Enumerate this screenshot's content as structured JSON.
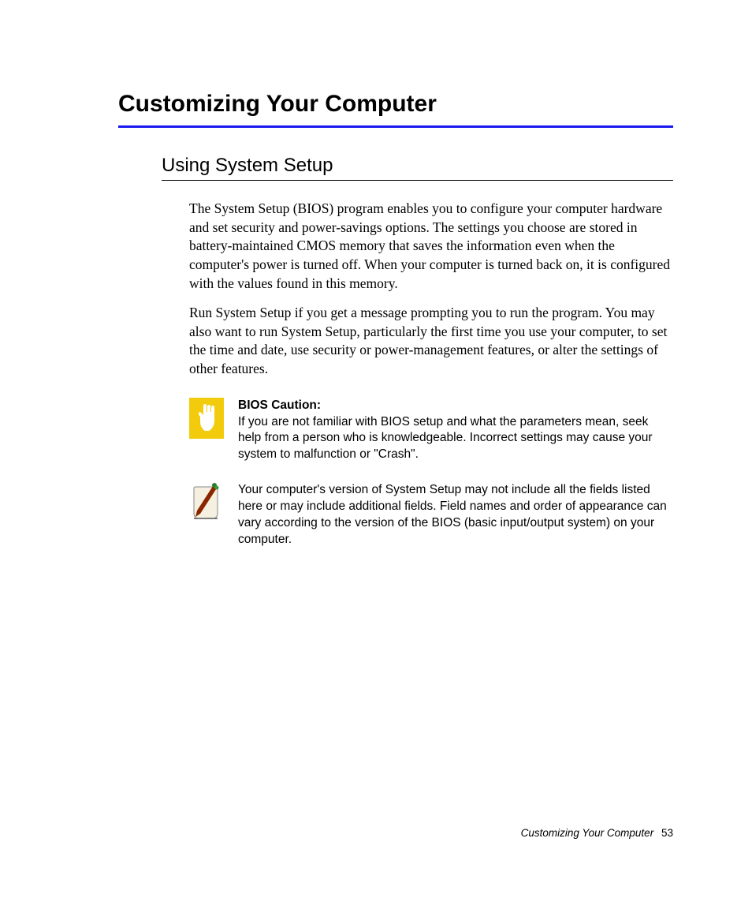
{
  "chapter_title": "Customizing Your Computer",
  "section_title": "Using System Setup",
  "paragraphs": {
    "p1": "The System Setup (BIOS) program enables you to configure your computer hardware and set security and power-savings options. The settings you choose are stored in battery-maintained CMOS memory that saves the information even when the computer's power is turned off. When your computer is turned back on, it is configured with the values found in this memory.",
    "p2": "Run System Setup if you get a message prompting you to run the program. You may also want to run System Setup, particularly the first time you use your computer, to set the time and date, use security or power-management features, or alter the settings of other features."
  },
  "callouts": {
    "caution": {
      "title": "BIOS Caution:",
      "body": "If you are not familiar with BIOS setup and what the parameters mean, seek help from a person who is knowledgeable. Incorrect settings may cause your system to malfunction or \"Crash\"."
    },
    "note": {
      "body": "Your computer's version of System Setup may not include all the fields listed here or may include additional fields. Field names and order of appearance can vary according to the version of the BIOS (basic input/output system) on your computer."
    }
  },
  "footer": {
    "title": "Customizing Your Computer",
    "page_number": "53"
  }
}
